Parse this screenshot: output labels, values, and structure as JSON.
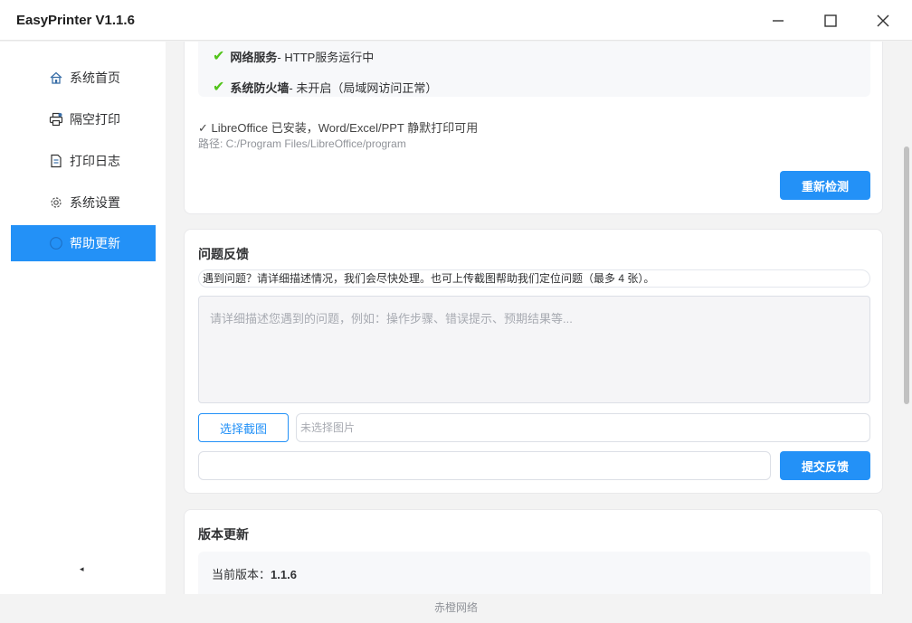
{
  "window": {
    "title": "EasyPrinter  V1.1.6",
    "minimize_icon": "minimize-icon",
    "maximize_icon": "maximize-icon",
    "close_icon": "close-icon"
  },
  "sidebar": {
    "items": [
      {
        "label": "系统首页",
        "icon": "home-icon"
      },
      {
        "label": "隔空打印",
        "icon": "printer-icon"
      },
      {
        "label": "打印日志",
        "icon": "document-icon"
      },
      {
        "label": "系统设置",
        "icon": "gear-icon"
      },
      {
        "label": "帮助更新",
        "icon": "circle-icon",
        "active": true
      }
    ],
    "collapse_glyph": "◂"
  },
  "status": {
    "rows": [
      {
        "name": "网络服务",
        "detail": " - HTTP服务运行中"
      },
      {
        "name": "系统防火墙",
        "detail": " - 未开启（局域网访问正常）"
      }
    ],
    "check_glyph": "✔",
    "libreoffice_line": "✓ LibreOffice 已安装，Word/Excel/PPT 静默打印可用",
    "libreoffice_path": "路径: C:/Program Files/LibreOffice/program",
    "recheck_label": "重新检测"
  },
  "feedback": {
    "title": "问题反馈",
    "hint": "遇到问题？请详细描述情况，我们会尽快处理。也可上传截图帮助我们定位问题（最多 4 张）。",
    "textarea_placeholder": "请详细描述您遇到的问题，例如：操作步骤、错误提示、预期结果等...",
    "choose_screenshot_label": "选择截图",
    "no_image_text": "未选择图片",
    "contact_value": "",
    "submit_label": "提交反馈"
  },
  "update": {
    "title": "版本更新",
    "current_version_label": "当前版本：",
    "current_version": "1.1.6"
  },
  "footer": {
    "text": "赤橙网络"
  },
  "colors": {
    "accent": "#2391f7",
    "success": "#52c41a"
  }
}
